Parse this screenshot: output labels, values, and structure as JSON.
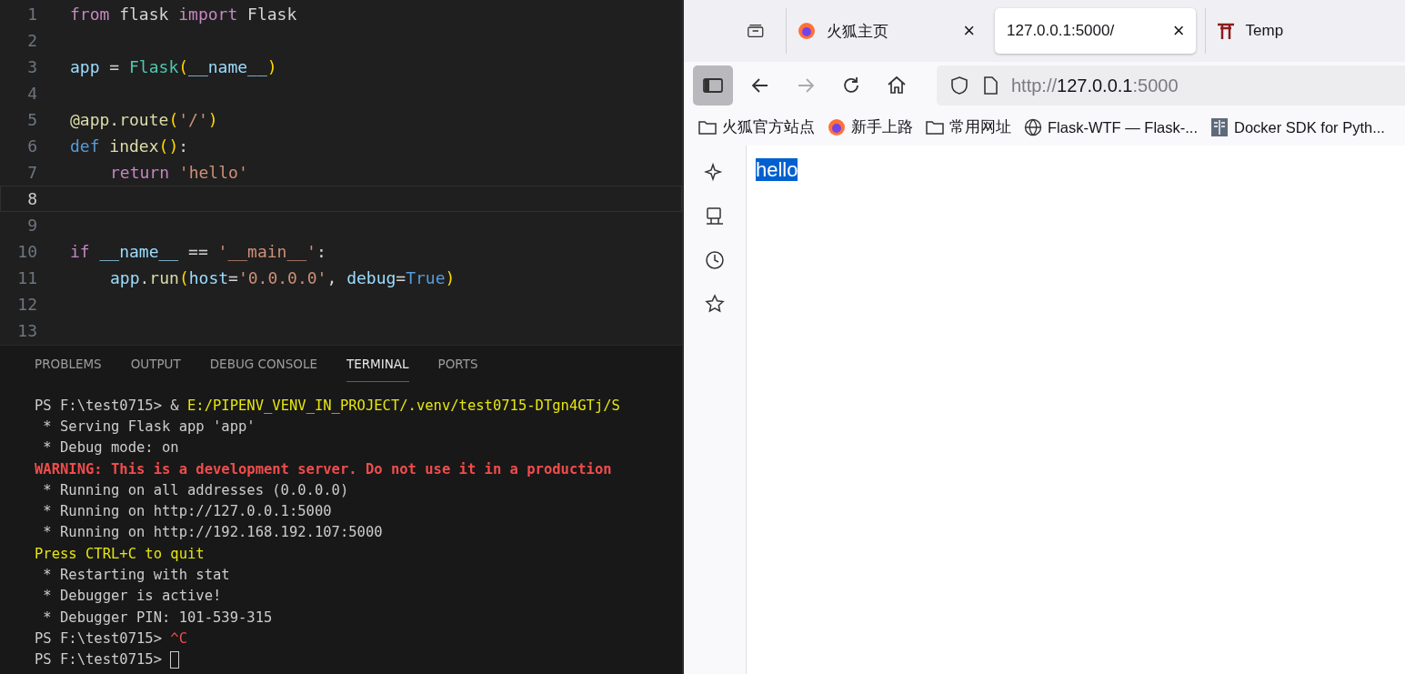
{
  "editor": {
    "lines": [
      {
        "number": "1",
        "active": false,
        "tokens": [
          {
            "kind": "keyword",
            "text": "from"
          },
          {
            "kind": "plain",
            "text": " flask "
          },
          {
            "kind": "keyword",
            "text": "import"
          },
          {
            "kind": "plain",
            "text": " Flask"
          }
        ]
      },
      {
        "number": "2",
        "active": false
      },
      {
        "number": "3",
        "active": false,
        "tokens": [
          {
            "kind": "var",
            "text": "app"
          },
          {
            "kind": "plain",
            "text": " = "
          },
          {
            "kind": "class",
            "text": "Flask"
          },
          {
            "kind": "paren",
            "text": "("
          },
          {
            "kind": "var",
            "text": "__name__"
          },
          {
            "kind": "paren",
            "text": ")"
          }
        ]
      },
      {
        "number": "4",
        "active": false
      },
      {
        "number": "5",
        "active": false,
        "tokens": [
          {
            "kind": "func",
            "text": "@app.route"
          },
          {
            "kind": "paren",
            "text": "("
          },
          {
            "kind": "string",
            "text": "'/'"
          },
          {
            "kind": "paren",
            "text": ")"
          }
        ]
      },
      {
        "number": "6",
        "active": false,
        "tokens": [
          {
            "kind": "def",
            "text": "def "
          },
          {
            "kind": "func",
            "text": "index"
          },
          {
            "kind": "paren",
            "text": "()"
          },
          {
            "kind": "plain",
            "text": ":"
          }
        ]
      },
      {
        "number": "7",
        "active": false,
        "indented": true,
        "tokens": [
          {
            "kind": "keyword",
            "text": "return "
          },
          {
            "kind": "string",
            "text": "'hello'"
          }
        ]
      },
      {
        "number": "8",
        "active": true
      },
      {
        "number": "9",
        "active": false
      },
      {
        "number": "10",
        "active": false,
        "tokens": [
          {
            "kind": "keyword",
            "text": "if "
          },
          {
            "kind": "var",
            "text": "__name__"
          },
          {
            "kind": "plain",
            "text": " == "
          },
          {
            "kind": "string",
            "text": "'__main__'"
          },
          {
            "kind": "plain",
            "text": ":"
          }
        ]
      },
      {
        "number": "11",
        "active": false,
        "indented": true,
        "tokens": [
          {
            "kind": "var",
            "text": "app"
          },
          {
            "kind": "plain",
            "text": "."
          },
          {
            "kind": "func",
            "text": "run"
          },
          {
            "kind": "paren",
            "text": "("
          },
          {
            "kind": "var",
            "text": "host"
          },
          {
            "kind": "plain",
            "text": "="
          },
          {
            "kind": "string",
            "text": "'0.0.0.0'"
          },
          {
            "kind": "plain",
            "text": ", "
          },
          {
            "kind": "var",
            "text": "debug"
          },
          {
            "kind": "plain",
            "text": "="
          },
          {
            "kind": "def",
            "text": "True"
          },
          {
            "kind": "paren",
            "text": ")"
          }
        ]
      },
      {
        "number": "12",
        "active": false
      },
      {
        "number": "13",
        "active": false
      }
    ]
  },
  "panel": {
    "tabs": [
      {
        "label": "PROBLEMS",
        "selected": false
      },
      {
        "label": "OUTPUT",
        "selected": false
      },
      {
        "label": "DEBUG CONSOLE",
        "selected": false
      },
      {
        "label": "TERMINAL",
        "selected": true
      },
      {
        "label": "PORTS",
        "selected": false
      }
    ],
    "terminal": [
      [
        {
          "kind": "plain",
          "text": "PS F:\\test0715> & "
        },
        {
          "kind": "yellow",
          "text": "E:/PIPENV_VENV_IN_PROJECT/.venv/test0715-DTgn4GTj/S"
        }
      ],
      [
        {
          "kind": "plain",
          "text": " * Serving Flask app 'app'"
        }
      ],
      [
        {
          "kind": "plain",
          "text": " * Debug mode: on"
        }
      ],
      [
        {
          "kind": "warning",
          "text": "WARNING: This is a development server. Do not use it in a production"
        }
      ],
      [
        {
          "kind": "plain",
          "text": " * Running on all addresses (0.0.0.0)"
        }
      ],
      [
        {
          "kind": "plain",
          "text": " * Running on http://127.0.0.1:5000"
        }
      ],
      [
        {
          "kind": "plain",
          "text": " * Running on http://192.168.192.107:5000"
        }
      ],
      [
        {
          "kind": "yellow",
          "text": "Press CTRL+C to quit"
        }
      ],
      [
        {
          "kind": "plain",
          "text": " * Restarting with stat"
        }
      ],
      [
        {
          "kind": "plain",
          "text": " * Debugger is active!"
        }
      ],
      [
        {
          "kind": "plain",
          "text": " * Debugger PIN: 101-539-315"
        }
      ],
      [
        {
          "kind": "plain",
          "text": "PS F:\\test0715> "
        },
        {
          "kind": "red",
          "text": "^C"
        }
      ],
      [
        {
          "kind": "plain",
          "text": "PS F:\\test0715> "
        },
        {
          "kind": "cursor"
        }
      ]
    ]
  },
  "browser": {
    "tabs": [
      {
        "kind": "firefox",
        "label": "火狐主页",
        "close": "×",
        "selected": false
      },
      {
        "kind": "plain",
        "label": "127.0.0.1:5000/",
        "close": "×",
        "selected": true
      },
      {
        "kind": "gate",
        "label": "Temp",
        "selected": false
      }
    ],
    "url": {
      "scheme": "http://",
      "host": "127.0.0.1",
      "port": ":5000"
    },
    "bookmarks": [
      {
        "kind": "folder",
        "label": "火狐官方站点"
      },
      {
        "kind": "firefox",
        "label": "新手上路"
      },
      {
        "kind": "folder",
        "label": "常用网址"
      },
      {
        "kind": "globe",
        "label": "Flask-WTF — Flask-..."
      },
      {
        "kind": "doc",
        "label": "Docker SDK for Pyth..."
      }
    ],
    "page": {
      "text": "hello",
      "selected": true
    }
  }
}
